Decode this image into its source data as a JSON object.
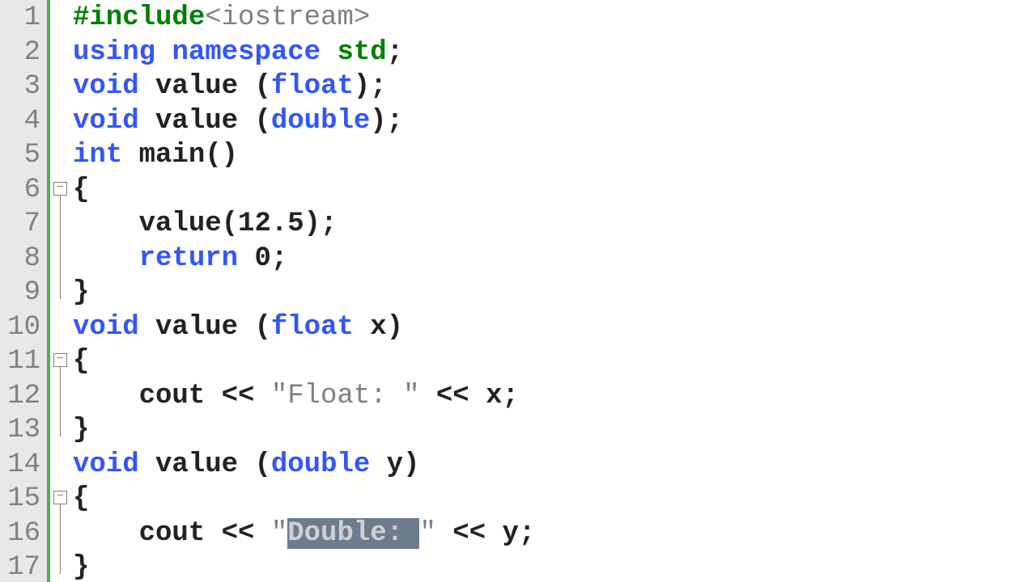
{
  "editor": {
    "language": "cpp",
    "line_start": 1,
    "line_count": 17,
    "fold_points": [
      {
        "line": 6
      },
      {
        "line": 11
      },
      {
        "line": 15
      }
    ],
    "fold_lines": [
      {
        "from": 6,
        "to": 9
      },
      {
        "from": 11,
        "to": 13
      },
      {
        "from": 15,
        "to": 17
      }
    ],
    "selection": {
      "line": 16,
      "text": "Double: "
    },
    "lines": [
      {
        "n": 1,
        "tokens": [
          {
            "t": "#include",
            "c": "pre"
          },
          {
            "t": "<iostream>",
            "c": "str"
          }
        ]
      },
      {
        "n": 2,
        "tokens": [
          {
            "t": "using",
            "c": "kw"
          },
          {
            "t": " "
          },
          {
            "t": "namespace",
            "c": "kw"
          },
          {
            "t": " "
          },
          {
            "t": "std",
            "c": "pre"
          },
          {
            "t": ";"
          }
        ]
      },
      {
        "n": 3,
        "tokens": [
          {
            "t": "void",
            "c": "kw"
          },
          {
            "t": " value ("
          },
          {
            "t": "float",
            "c": "kw"
          },
          {
            "t": ");"
          }
        ]
      },
      {
        "n": 4,
        "tokens": [
          {
            "t": "void",
            "c": "kw"
          },
          {
            "t": " value ("
          },
          {
            "t": "double",
            "c": "kw"
          },
          {
            "t": ");"
          }
        ]
      },
      {
        "n": 5,
        "tokens": [
          {
            "t": "int",
            "c": "kw"
          },
          {
            "t": " main()"
          }
        ]
      },
      {
        "n": 6,
        "tokens": [
          {
            "t": "{"
          }
        ]
      },
      {
        "n": 7,
        "tokens": [
          {
            "t": "    value("
          },
          {
            "t": "12.5",
            "c": "num"
          },
          {
            "t": ");"
          }
        ]
      },
      {
        "n": 8,
        "tokens": [
          {
            "t": "    "
          },
          {
            "t": "return",
            "c": "kw"
          },
          {
            "t": " "
          },
          {
            "t": "0",
            "c": "num"
          },
          {
            "t": ";"
          }
        ]
      },
      {
        "n": 9,
        "tokens": [
          {
            "t": "}"
          }
        ]
      },
      {
        "n": 10,
        "tokens": [
          {
            "t": "void",
            "c": "kw"
          },
          {
            "t": " value ("
          },
          {
            "t": "float",
            "c": "kw"
          },
          {
            "t": " x)"
          }
        ]
      },
      {
        "n": 11,
        "tokens": [
          {
            "t": "{"
          }
        ]
      },
      {
        "n": 12,
        "tokens": [
          {
            "t": "    cout << "
          },
          {
            "t": "\"Float: \"",
            "c": "str"
          },
          {
            "t": " << x;"
          }
        ]
      },
      {
        "n": 13,
        "tokens": [
          {
            "t": "}"
          }
        ]
      },
      {
        "n": 14,
        "tokens": [
          {
            "t": "void",
            "c": "kw"
          },
          {
            "t": " value ("
          },
          {
            "t": "double",
            "c": "kw"
          },
          {
            "t": " y)"
          }
        ]
      },
      {
        "n": 15,
        "tokens": [
          {
            "t": "{"
          }
        ]
      },
      {
        "n": 16,
        "tokens": [
          {
            "t": "    cout << "
          },
          {
            "t": "\"",
            "c": "str"
          },
          {
            "t": "Double: ",
            "c": "sel"
          },
          {
            "t": "\"",
            "c": "str"
          },
          {
            "t": " << y;"
          }
        ]
      },
      {
        "n": 17,
        "tokens": [
          {
            "t": "}"
          }
        ]
      }
    ]
  }
}
